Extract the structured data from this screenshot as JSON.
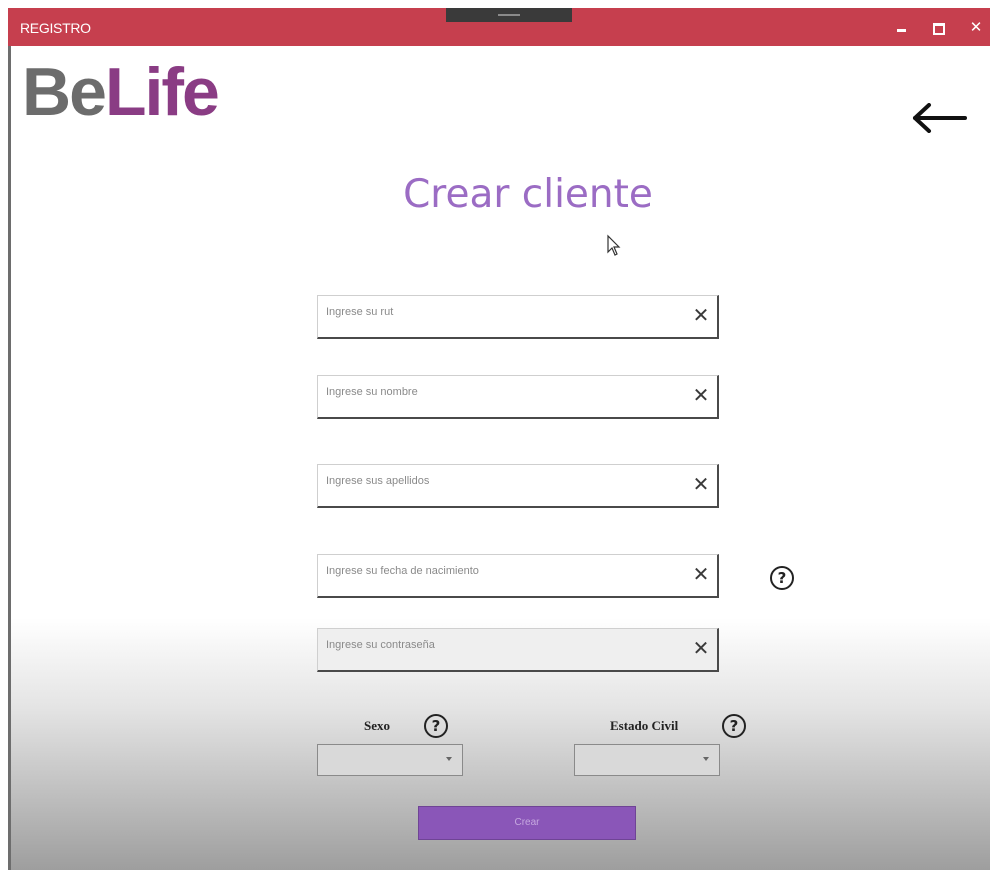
{
  "window": {
    "title": "REGISTRO",
    "min_icon": "minimize-icon",
    "max_icon": "maximize-icon",
    "close_glyph": "✕"
  },
  "logo": {
    "part1": "Be",
    "part2": "Life",
    "color1": "#6c6c6c",
    "color2": "#8a3c84"
  },
  "header": {
    "back_icon": "arrow-left-icon"
  },
  "page": {
    "title": "Crear cliente",
    "title_color": "#9b6cc4"
  },
  "form": {
    "fields": [
      {
        "placeholder": "Ingrese su rut",
        "clear": "✕"
      },
      {
        "placeholder": "Ingrese su nombre",
        "clear": "✕"
      },
      {
        "placeholder": "Ingrese sus apellidos",
        "clear": "✕"
      },
      {
        "placeholder": "Ingrese su fecha de nacimiento",
        "clear": "✕"
      },
      {
        "placeholder": "Ingrese su contraseña",
        "clear": "✕"
      }
    ],
    "help_glyph": "?",
    "sexo_label": "Sexo",
    "estado_civil_label": "Estado Civil",
    "submit_label": "Crear",
    "accent_color": "#8a56b8"
  },
  "colors": {
    "titlebar": "#c63f4e"
  }
}
